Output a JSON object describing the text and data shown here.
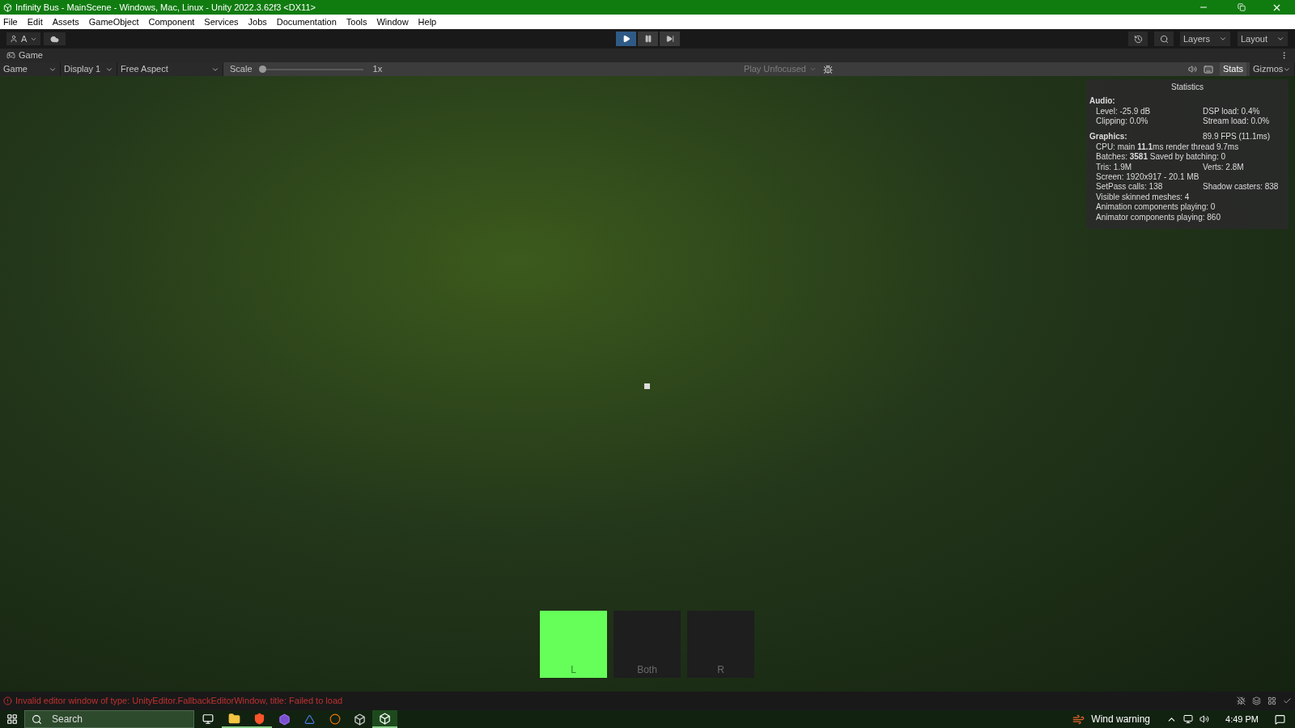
{
  "window": {
    "title": "Infinity Bus - MainScene - Windows, Mac, Linux - Unity 2022.3.62f3 <DX11>"
  },
  "menu": [
    "File",
    "Edit",
    "Assets",
    "GameObject",
    "Component",
    "Services",
    "Jobs",
    "Documentation",
    "Tools",
    "Window",
    "Help"
  ],
  "toolbar": {
    "account": "A",
    "play": {
      "selected": true
    },
    "pause": {
      "selected": false
    },
    "step": {
      "selected": false
    },
    "layers": "Layers",
    "layout": "Layout"
  },
  "game_tab": {
    "label": "Game"
  },
  "game_toolbar": {
    "view": "Game",
    "display": "Display 1",
    "aspect": "Free Aspect",
    "scale_label": "Scale",
    "scale": {
      "level": 0.0
    },
    "scale_value": "1x",
    "play_mode": "Play Unfocused",
    "stats": {
      "label": "Stats",
      "selected": true
    },
    "gizmos": "Gizmos"
  },
  "statistics": {
    "title": "Statistics",
    "sections": [
      {
        "heading": "Audio:",
        "rows": [
          {
            "left": "Level: -25.9 dB",
            "right": "DSP load: 0.4%"
          },
          {
            "left": "Clipping: 0.0%",
            "right": "Stream load: 0.0%"
          }
        ]
      },
      {
        "heading": "Graphics:",
        "heading_right": "89.9 FPS (11.1ms)",
        "rows": [
          {
            "left": "CPU: main **11.1**ms  render thread 9.7ms"
          },
          {
            "left": "Batches: **3581**   Saved by batching: 0"
          },
          {
            "left": "Tris: 1.9M",
            "right": "Verts: 2.8M"
          },
          {
            "left": "Screen: 1920x917 - 20.1 MB"
          },
          {
            "left": "SetPass calls: 138",
            "right": "Shadow casters: 838"
          },
          {
            "left": "Visible skinned meshes: 4"
          },
          {
            "left": "Animation components playing: 0"
          },
          {
            "left": "Animator components playing: 860"
          }
        ]
      }
    ]
  },
  "hud_buttons": [
    {
      "label": "L",
      "selected": true
    },
    {
      "label": "Both",
      "selected": false
    },
    {
      "label": "R",
      "selected": false
    }
  ],
  "status_bar": {
    "message": "Invalid editor window of type: UnityEditor.FallbackEditorWindow, title: Failed to load"
  },
  "taskbar": {
    "search": {
      "placeholder": "Search"
    },
    "apps": [
      {
        "kind": "folder",
        "running": true,
        "selected": false
      },
      {
        "kind": "browser",
        "running": true,
        "selected": false
      },
      {
        "kind": "studio",
        "running": false,
        "selected": false
      },
      {
        "kind": "arrow",
        "running": false,
        "selected": false
      },
      {
        "kind": "blender",
        "running": false,
        "selected": false
      },
      {
        "kind": "cube",
        "running": false,
        "selected": false
      },
      {
        "kind": "unity",
        "running": true,
        "selected": true
      }
    ],
    "weather": "Wind warning",
    "clock": "4:49 PM"
  }
}
